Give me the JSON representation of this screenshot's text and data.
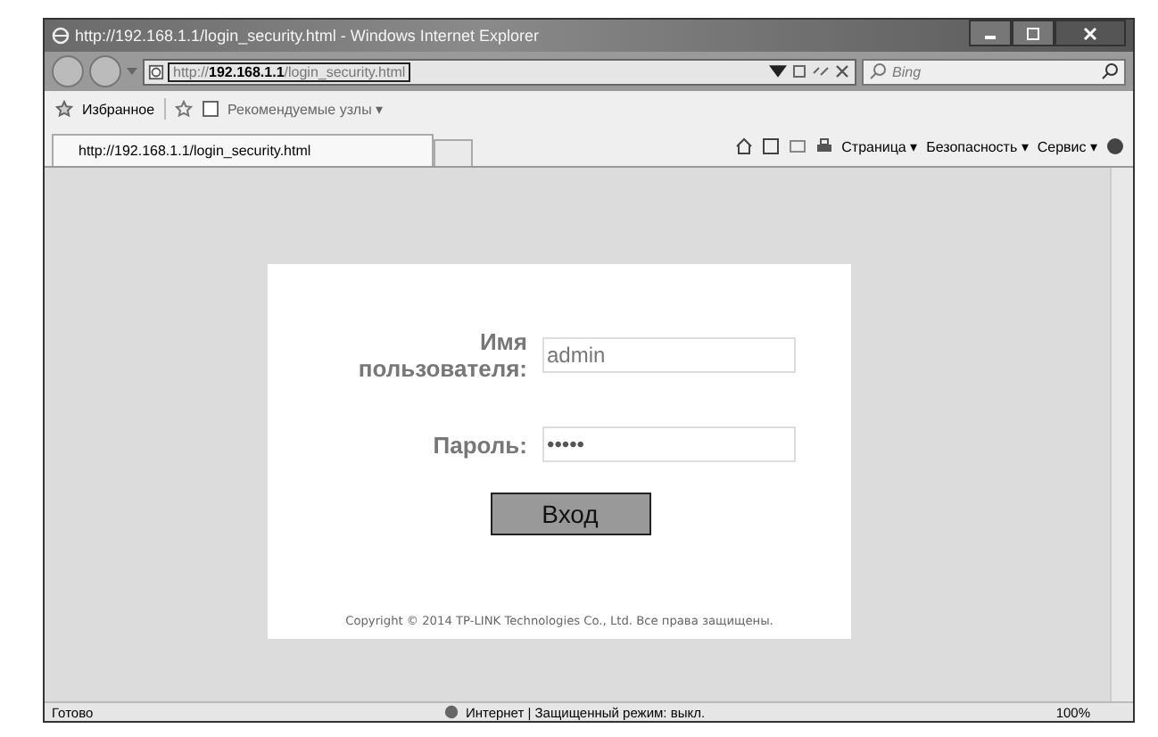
{
  "window": {
    "title": "http://192.168.1.1/login_security.html - Windows Internet Explorer"
  },
  "address_bar": {
    "value_prefix": "http://",
    "value_host": "192.168.1.1",
    "value_path": "/login_security.html"
  },
  "search": {
    "placeholder": "Bing"
  },
  "favorites_bar": {
    "favorites": "Избранное",
    "suggested": "Рекомендуемые узлы ▾"
  },
  "tab": {
    "title": "http://192.168.1.1/login_security.html"
  },
  "command_bar": [
    "Страница ▾",
    "Безопасность ▾",
    "Сервис ▾"
  ],
  "login": {
    "username_label": "Имя пользователя:",
    "username": "admin",
    "password_label": "Пароль:",
    "password": "•••••",
    "button": "Вход",
    "copyright": "Copyright © 2014 TP-LINK Technologies Co., Ltd. Все права защищены."
  },
  "status_bar": {
    "status": "Готово",
    "zone": "Интернет | Защищенный режим: выкл.",
    "zoom": "100%"
  }
}
